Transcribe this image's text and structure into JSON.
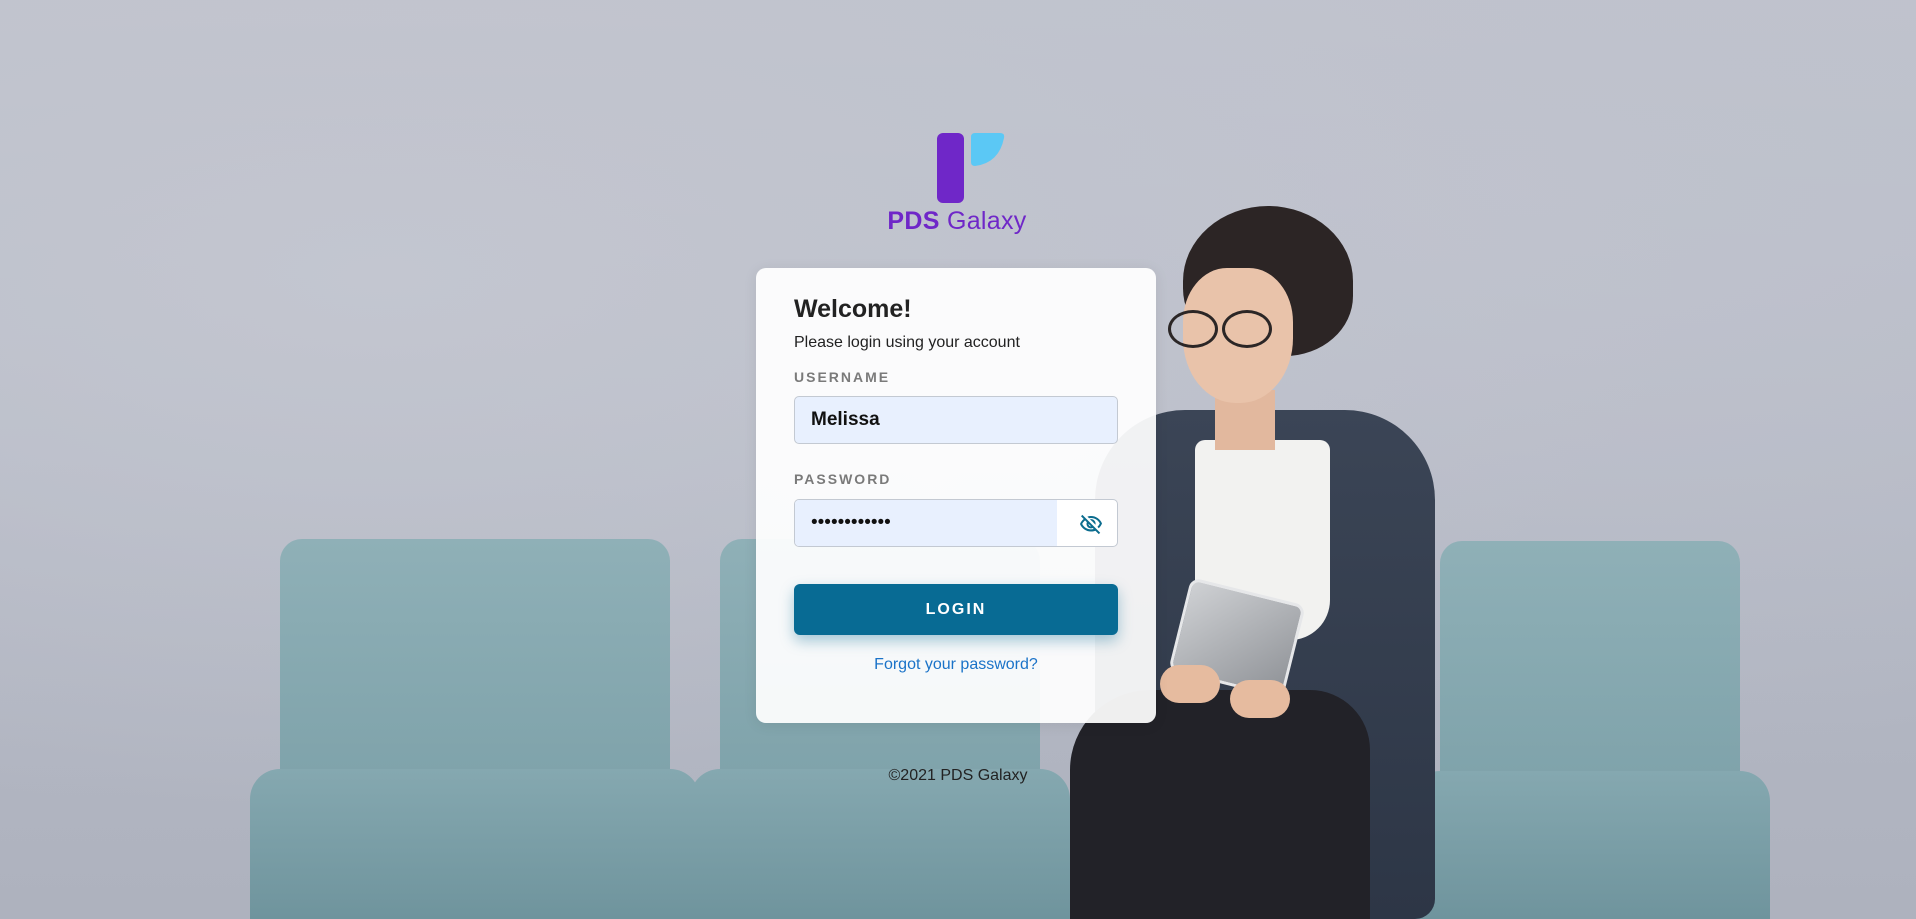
{
  "brand": {
    "name_bold": "PDS",
    "name_regular": "Galaxy",
    "logo_icon": "pds-galaxy-logo-icon",
    "colors": {
      "purple": "#6f27c8",
      "light_blue": "#5bc8f5"
    }
  },
  "login": {
    "title": "Welcome!",
    "subtitle": "Please login using your account",
    "username_label": "USERNAME",
    "username_value": "Melissa",
    "password_label": "PASSWORD",
    "password_value": "••••••••••••",
    "password_toggle_icon": "eye-off-icon",
    "login_button": "LOGIN",
    "forgot_link": "Forgot your password?",
    "button_color": "#086b94",
    "link_color": "#1a73c8"
  },
  "footer": {
    "copyright": "©2021 PDS Galaxy"
  }
}
